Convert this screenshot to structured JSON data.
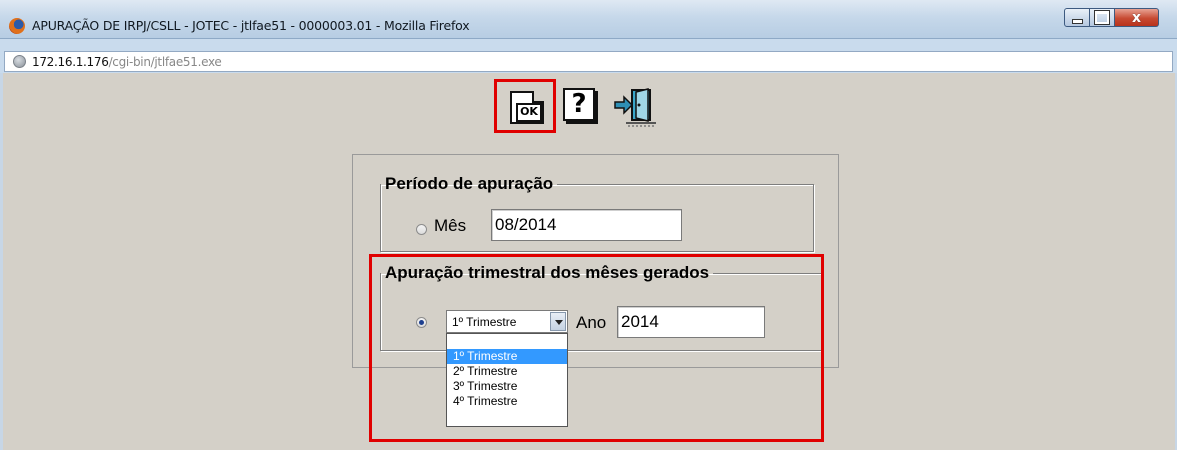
{
  "window": {
    "title": "APURAÇÃO DE IRPJ/CSLL - JOTEC - jtlfae51 - 0000003.01 - Mozilla Firefox",
    "close_glyph": "x"
  },
  "address": {
    "host": "172.16.1.176",
    "path": "/cgi-bin/jtlfae51.exe"
  },
  "toolbar": {
    "ok_label": "OK",
    "help_glyph": "?"
  },
  "periodo": {
    "legend": "Período de apuração",
    "mes_label": "Mês",
    "mes_value": "08/2014",
    "selected": false
  },
  "trimestral": {
    "legend": "Apuração trimestral dos mêses gerados",
    "selected": true,
    "trimestre_value": "1º Trimestre",
    "ano_label": "Ano",
    "ano_value": "2014",
    "options": [
      "",
      "1º Trimestre",
      "2º Trimestre",
      "3º Trimestre",
      "4º Trimestre"
    ],
    "highlighted_option": "1º Trimestre"
  },
  "colors": {
    "highlight": "#e00000",
    "selection": "#3399ff",
    "background": "#d4d0c8"
  }
}
